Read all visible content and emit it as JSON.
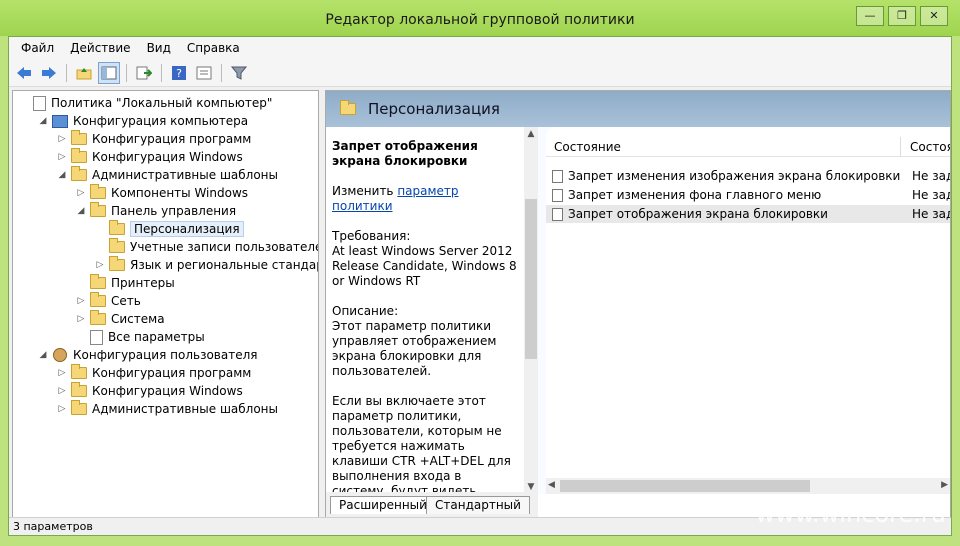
{
  "window": {
    "title": "Редактор локальной групповой политики",
    "btn_minimize": "—",
    "btn_restore": "❐",
    "btn_close": "✕"
  },
  "menu": [
    "Файл",
    "Действие",
    "Вид",
    "Справка"
  ],
  "toolbar": [
    "back-icon",
    "forward-icon",
    "up-folder-icon",
    "show-pane-icon",
    "export-icon",
    "help-icon",
    "properties-icon",
    "filter-icon"
  ],
  "tree": [
    {
      "label": "Политика \"Локальный компьютер\"",
      "icon": "doc",
      "indent": 0,
      "arrow": ""
    },
    {
      "label": "Конфигурация компьютера",
      "icon": "computer",
      "indent": 1,
      "arrow": "◢"
    },
    {
      "label": "Конфигурация программ",
      "icon": "folder",
      "indent": 2,
      "arrow": "▷"
    },
    {
      "label": "Конфигурация Windows",
      "icon": "folder",
      "indent": 2,
      "arrow": "▷"
    },
    {
      "label": "Административные шаблоны",
      "icon": "folder",
      "indent": 2,
      "arrow": "◢"
    },
    {
      "label": "Компоненты Windows",
      "icon": "folder",
      "indent": 3,
      "arrow": "▷"
    },
    {
      "label": "Панель управления",
      "icon": "folder",
      "indent": 3,
      "arrow": "◢"
    },
    {
      "label": "Персонализация",
      "icon": "folder",
      "indent": 4,
      "arrow": "",
      "selected": true
    },
    {
      "label": "Учетные записи пользователей",
      "icon": "folder",
      "indent": 4,
      "arrow": ""
    },
    {
      "label": "Язык и региональные стандарты",
      "icon": "folder",
      "indent": 4,
      "arrow": "▷"
    },
    {
      "label": "Принтеры",
      "icon": "folder",
      "indent": 3,
      "arrow": ""
    },
    {
      "label": "Сеть",
      "icon": "folder",
      "indent": 3,
      "arrow": "▷"
    },
    {
      "label": "Система",
      "icon": "folder",
      "indent": 3,
      "arrow": "▷"
    },
    {
      "label": "Все параметры",
      "icon": "doc",
      "indent": 3,
      "arrow": ""
    },
    {
      "label": "Конфигурация пользователя",
      "icon": "user",
      "indent": 1,
      "arrow": "◢"
    },
    {
      "label": "Конфигурация программ",
      "icon": "folder",
      "indent": 2,
      "arrow": "▷"
    },
    {
      "label": "Конфигурация Windows",
      "icon": "folder",
      "indent": 2,
      "arrow": "▷"
    },
    {
      "label": "Административные шаблоны",
      "icon": "folder",
      "indent": 2,
      "arrow": "▷"
    }
  ],
  "right": {
    "header_title": "Персонализация",
    "desc_title": "Запрет отображения экрана блокировки",
    "edit_prefix": "Изменить ",
    "edit_link": "параметр политики",
    "requirements_label": "Требования:",
    "requirements_text": "At least Windows Server 2012 Release Candidate, Windows 8 or Windows RT",
    "description_label": "Описание:",
    "description_text": "Этот параметр политики управляет отображением экрана блокировки для пользователей.",
    "description_text2": "Если вы включаете этот параметр политики, пользователи, которым не требуется нажимать клавиши CTR +ALT+DEL для выполнения входа в систему, будут видеть выбранную ими плитку после б",
    "col_state": "Состояние",
    "col_state2": "Состоян",
    "rows": [
      {
        "name": "Запрет изменения изображения экрана блокировки",
        "state": "Не задан"
      },
      {
        "name": "Запрет изменения фона главного меню",
        "state": "Не задан"
      },
      {
        "name": "Запрет отображения экрана блокировки",
        "state": "Не задан",
        "selected": true
      }
    ],
    "tab_extended": "Расширенный",
    "tab_standard": "Стандартный"
  },
  "status": "3 параметров",
  "watermark": "www.wincore.ru"
}
